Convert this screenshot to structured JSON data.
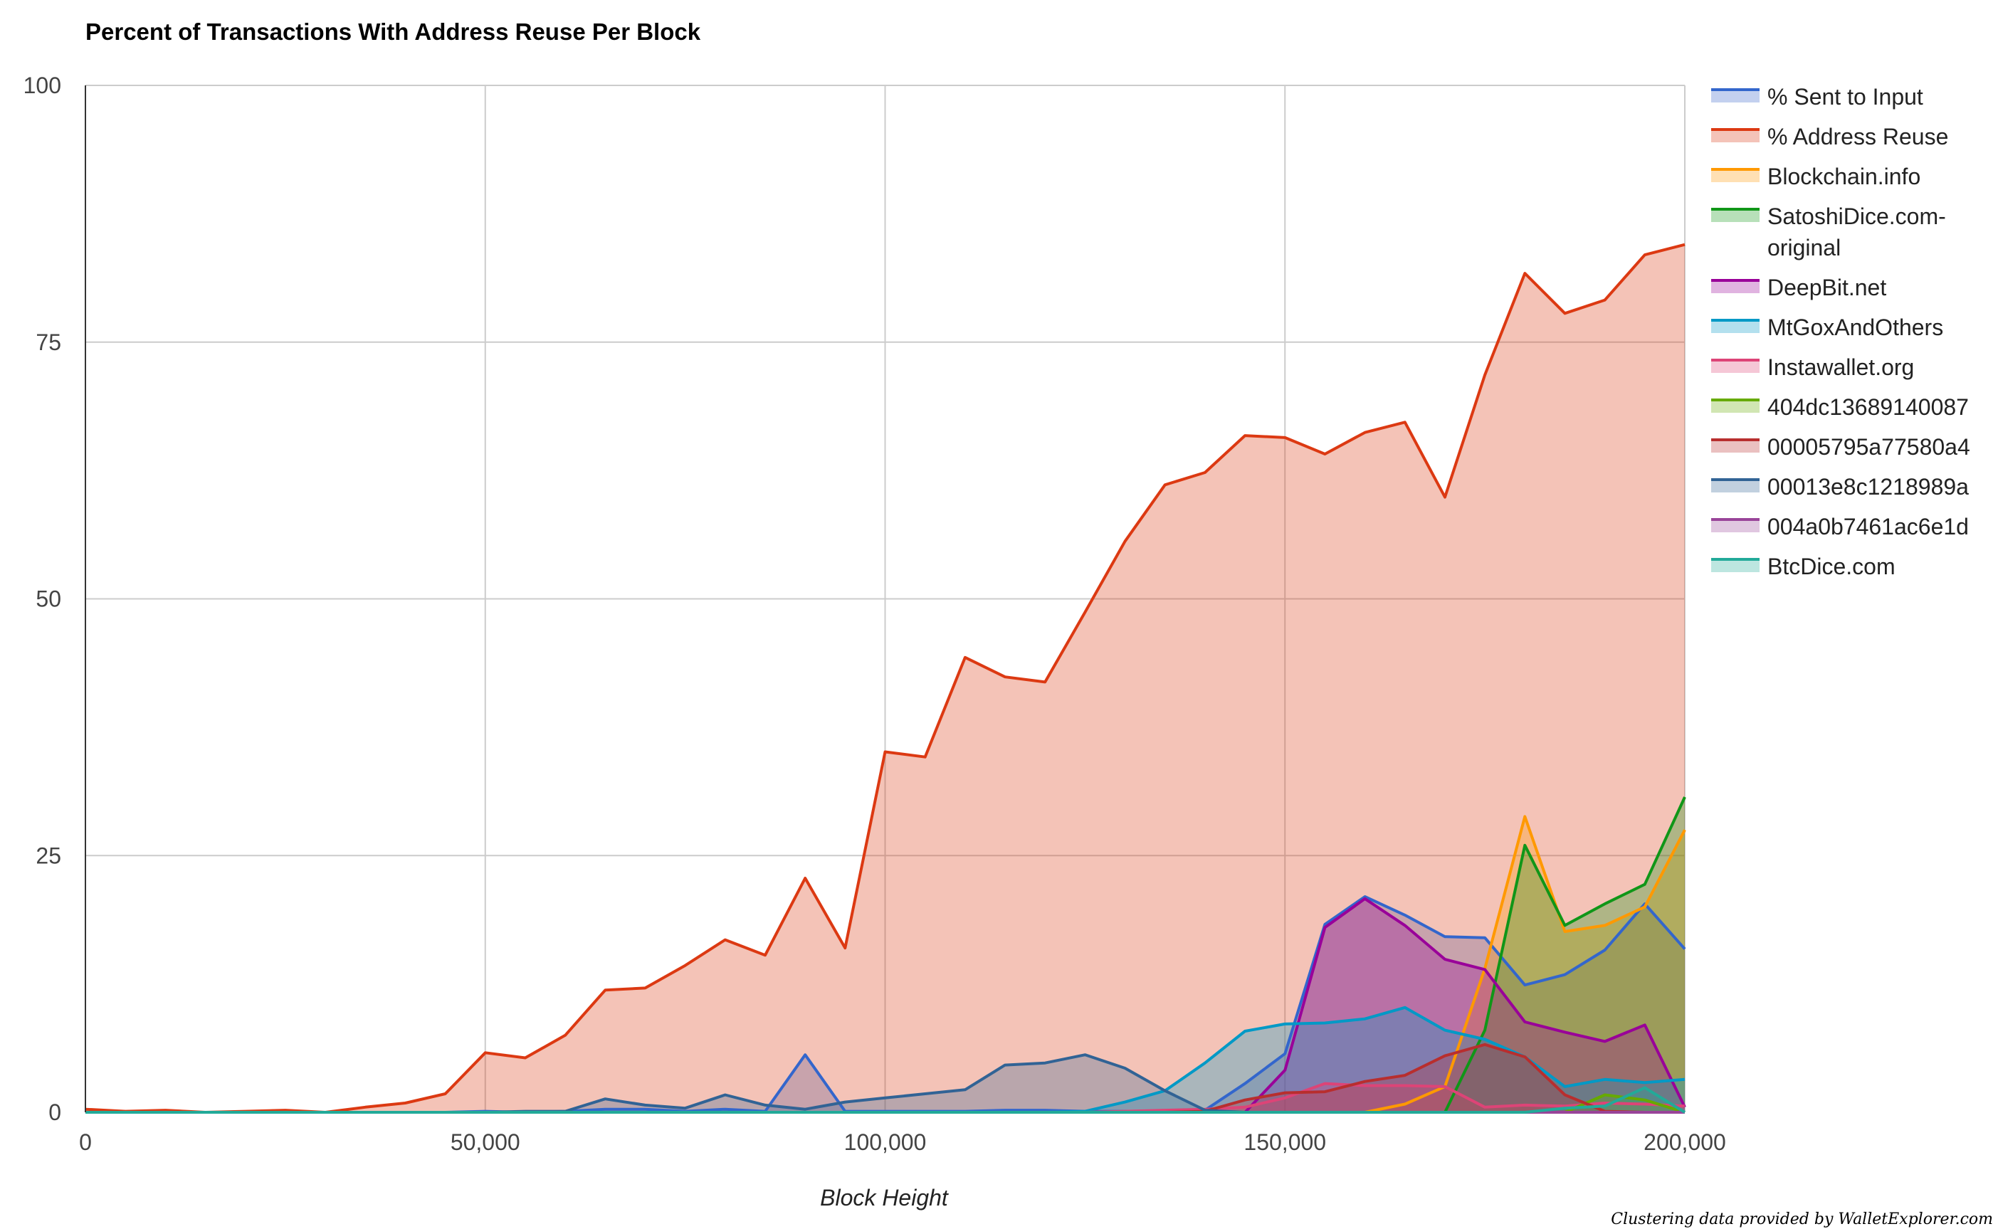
{
  "chart_data": {
    "type": "area",
    "title": "Percent of Transactions With Address Reuse Per Block",
    "xlabel": "Block Height",
    "ylabel": "",
    "xlim": [
      0,
      200000
    ],
    "ylim": [
      0,
      100
    ],
    "x_ticks": [
      0,
      50000,
      100000,
      150000,
      200000
    ],
    "x_tick_labels": [
      "0",
      "50,000",
      "100,000",
      "150,000",
      "200,000"
    ],
    "y_ticks": [
      0,
      25,
      50,
      75,
      100
    ],
    "y_tick_labels": [
      "0",
      "25",
      "50",
      "75",
      "100"
    ],
    "grid": true,
    "legend_position": "right",
    "footnote": "Clustering data provided by WalletExplorer.com",
    "x": [
      0,
      5000,
      10000,
      15000,
      20000,
      25000,
      30000,
      35000,
      40000,
      45000,
      50000,
      55000,
      60000,
      65000,
      70000,
      75000,
      80000,
      85000,
      90000,
      95000,
      100000,
      105000,
      110000,
      115000,
      120000,
      125000,
      130000,
      135000,
      140000,
      145000,
      150000,
      155000,
      160000,
      165000,
      170000,
      175000,
      180000,
      185000,
      190000,
      195000,
      200000
    ],
    "series": [
      {
        "name": "% Sent to Input",
        "color": "#3366cc",
        "fill": "#c3d0ef",
        "values": [
          0,
          0,
          0,
          0,
          0,
          0,
          0,
          0,
          0,
          0,
          0.1,
          0,
          0.1,
          0.3,
          0.3,
          0.1,
          0.3,
          0.1,
          5.6,
          0.1,
          0.1,
          0.1,
          0.1,
          0.2,
          0.2,
          0.1,
          0.1,
          0.1,
          0.2,
          2.8,
          5.7,
          18.3,
          21.0,
          19.2,
          17.1,
          17.0,
          12.4,
          13.4,
          15.8,
          20.3,
          15.9
        ]
      },
      {
        "name": "% Address Reuse",
        "color": "#dc3912",
        "fill": "#f4c3b8",
        "values": [
          0.3,
          0.1,
          0.2,
          0,
          0.1,
          0.2,
          0,
          0.5,
          0.9,
          1.8,
          5.8,
          5.3,
          7.5,
          11.9,
          12.1,
          14.3,
          16.8,
          15.3,
          22.8,
          16.0,
          35.1,
          34.6,
          44.3,
          42.4,
          41.9,
          48.7,
          55.6,
          61.1,
          62.3,
          65.9,
          65.7,
          64.1,
          66.2,
          67.2,
          59.9,
          71.8,
          81.7,
          77.8,
          79.1,
          83.5,
          84.5
        ]
      },
      {
        "name": "Blockchain.info",
        "color": "#ff9900",
        "fill": "#ffe0b3",
        "values": [
          0,
          0,
          0,
          0,
          0,
          0,
          0,
          0,
          0,
          0,
          0,
          0,
          0,
          0,
          0,
          0,
          0,
          0,
          0,
          0,
          0,
          0,
          0,
          0,
          0,
          0,
          0,
          0,
          0,
          0,
          0,
          0,
          0,
          0.8,
          2.5,
          14.0,
          28.8,
          17.6,
          18.2,
          20.0,
          27.5
        ]
      },
      {
        "name": "SatoshiDice.com-original",
        "color": "#109618",
        "fill": "#b7e0b9",
        "values": [
          0,
          0,
          0,
          0,
          0,
          0,
          0,
          0,
          0,
          0,
          0,
          0,
          0,
          0,
          0,
          0,
          0,
          0,
          0,
          0,
          0,
          0,
          0,
          0,
          0,
          0,
          0,
          0,
          0,
          0,
          0,
          0,
          0,
          0,
          0,
          8.0,
          26.0,
          18.2,
          20.3,
          22.2,
          30.7
        ]
      },
      {
        "name": "DeepBit.net",
        "color": "#990099",
        "fill": "#e0b3e0",
        "values": [
          0,
          0,
          0,
          0,
          0,
          0,
          0,
          0,
          0,
          0,
          0,
          0,
          0,
          0,
          0,
          0,
          0,
          0,
          0,
          0,
          0,
          0,
          0,
          0,
          0,
          0,
          0,
          0,
          0,
          0,
          4.1,
          18.0,
          20.8,
          18.2,
          14.9,
          13.9,
          8.8,
          7.8,
          6.9,
          8.5,
          0.5
        ]
      },
      {
        "name": "MtGoxAndOthers",
        "color": "#0099c6",
        "fill": "#b3e0ee",
        "values": [
          0,
          0,
          0,
          0,
          0,
          0,
          0,
          0,
          0,
          0,
          0,
          0,
          0,
          0,
          0,
          0,
          0,
          0,
          0,
          0,
          0,
          0,
          0,
          0,
          0,
          0.1,
          1.0,
          2.1,
          4.8,
          7.9,
          8.6,
          8.7,
          9.1,
          10.2,
          8.0,
          7.1,
          5.4,
          2.5,
          3.2,
          2.9,
          3.2
        ]
      },
      {
        "name": "Instawallet.org",
        "color": "#dd4477",
        "fill": "#f5c7d6",
        "values": [
          0,
          0,
          0,
          0,
          0,
          0,
          0,
          0,
          0,
          0,
          0,
          0,
          0,
          0,
          0,
          0,
          0,
          0,
          0,
          0,
          0,
          0,
          0,
          0,
          0,
          0,
          0.1,
          0.2,
          0.3,
          0.5,
          1.4,
          2.8,
          2.6,
          2.6,
          2.5,
          0.5,
          0.7,
          0.6,
          0.9,
          0.8,
          0.6
        ]
      },
      {
        "name": "404dc13689140087",
        "color": "#66aa00",
        "fill": "#d1e6b3",
        "values": [
          0,
          0,
          0,
          0,
          0,
          0,
          0,
          0,
          0,
          0,
          0,
          0,
          0,
          0,
          0,
          0,
          0,
          0,
          0,
          0,
          0,
          0,
          0,
          0,
          0,
          0,
          0,
          0,
          0,
          0,
          0,
          0,
          0,
          0,
          0,
          0,
          0,
          0,
          1.7,
          1.2,
          0
        ]
      },
      {
        "name": "00005795a77580a4",
        "color": "#b82e2e",
        "fill": "#eac0c0",
        "values": [
          0,
          0,
          0,
          0,
          0,
          0,
          0,
          0,
          0,
          0,
          0,
          0,
          0,
          0,
          0,
          0,
          0,
          0,
          0,
          0,
          0,
          0,
          0,
          0,
          0,
          0,
          0,
          0,
          0.1,
          1.2,
          1.9,
          2.0,
          3.0,
          3.6,
          5.5,
          6.6,
          5.4,
          1.7,
          0.1,
          0,
          0
        ]
      },
      {
        "name": "00013e8c1218989a",
        "color": "#316395",
        "fill": "#c1d0df",
        "values": [
          0,
          0,
          0,
          0,
          0,
          0,
          0,
          0,
          0,
          0,
          0,
          0.1,
          0.1,
          1.3,
          0.7,
          0.4,
          1.7,
          0.7,
          0.3,
          1.0,
          1.4,
          1.8,
          2.2,
          4.6,
          4.8,
          5.6,
          4.3,
          2.1,
          0.2,
          0,
          0,
          0,
          0,
          0,
          0,
          0,
          0,
          0,
          0,
          0,
          0
        ]
      },
      {
        "name": "004a0b7461ac6e1d",
        "color": "#994499",
        "fill": "#e0c7e0",
        "values": [
          0,
          0,
          0,
          0,
          0,
          0,
          0,
          0,
          0,
          0,
          0,
          0,
          0,
          0,
          0,
          0,
          0,
          0,
          0,
          0,
          0,
          0,
          0,
          0,
          0,
          0,
          0,
          0,
          0,
          0,
          0,
          0,
          0,
          0,
          0,
          0,
          0,
          0,
          0,
          0,
          0
        ]
      },
      {
        "name": "BtcDice.com",
        "color": "#22aa99",
        "fill": "#bde6e0",
        "values": [
          0,
          0,
          0,
          0,
          0,
          0,
          0,
          0,
          0,
          0,
          0,
          0,
          0,
          0,
          0,
          0,
          0,
          0,
          0,
          0,
          0,
          0,
          0,
          0,
          0,
          0,
          0,
          0,
          0,
          0,
          0,
          0,
          0,
          0,
          0,
          0,
          0,
          0.4,
          0.6,
          2.4,
          0
        ]
      }
    ]
  }
}
